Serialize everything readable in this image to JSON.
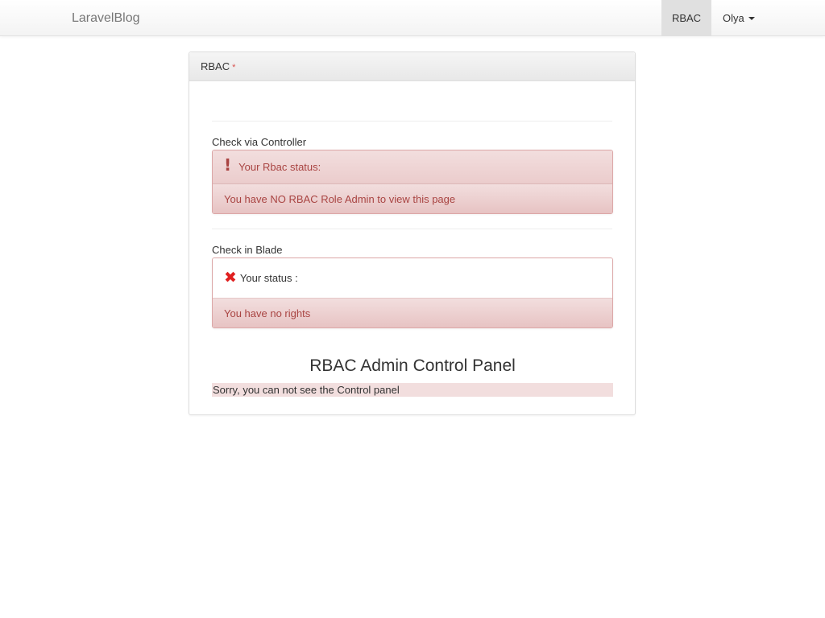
{
  "navbar": {
    "brand": "LaravelBlog",
    "rbac_link": "RBAC",
    "user_name": "Olya"
  },
  "panel": {
    "heading": "RBAC",
    "required_marker": "*",
    "controller_section": {
      "label": "Check via Controller",
      "status_title": "Your Rbac status:",
      "status_message": "You have NO RBAC Role Admin to view this page",
      "icon": "exclamation-icon"
    },
    "blade_section": {
      "label": "Check in Blade",
      "status_title": "Your status :",
      "status_message": "You have no rights",
      "icon": "cross-icon"
    },
    "control_panel": {
      "title": "RBAC Admin Control Panel",
      "message": "Sorry, you can not see the Control panel"
    }
  },
  "colors": {
    "danger_text": "#a94442",
    "danger_bg": "#f2dede",
    "cross_icon": "#e02020"
  }
}
